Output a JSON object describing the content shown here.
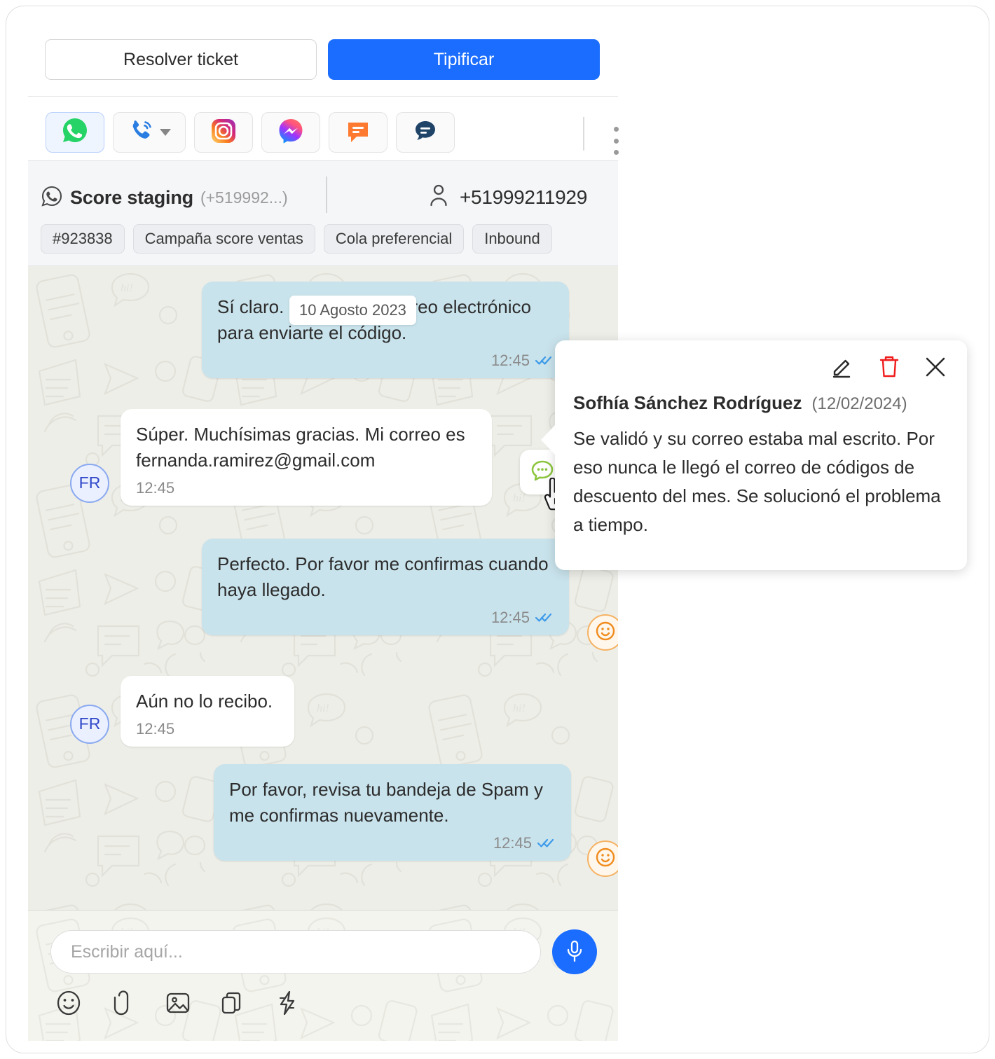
{
  "actions": {
    "resolve_label": "Resolver ticket",
    "typify_label": "Tipificar"
  },
  "channels": [
    {
      "name": "whatsapp",
      "icon": "whatsapp-icon",
      "active": true
    },
    {
      "name": "voice",
      "icon": "phone-call-icon",
      "active": false,
      "has_caret": true
    },
    {
      "name": "instagram",
      "icon": "instagram-icon",
      "active": false
    },
    {
      "name": "messenger",
      "icon": "messenger-icon",
      "active": false
    },
    {
      "name": "sms",
      "icon": "sms-bubble-icon",
      "active": false
    },
    {
      "name": "chat",
      "icon": "chat-bubble-icon",
      "active": false
    }
  ],
  "overflow_menu_icon": "kebab-menu-icon",
  "contact": {
    "channel_icon": "whatsapp-outline-icon",
    "account_name": "Score staging",
    "account_number": "(+519992...)",
    "person_icon": "person-icon",
    "phone": "+51999211929",
    "tags": [
      "#923838",
      "Campaña score ventas",
      "Cola preferencial",
      "Inbound"
    ]
  },
  "chat": {
    "date_divider": "10 Agosto 2023",
    "messages": [
      {
        "id": "m1",
        "direction": "out",
        "text": "Sí claro. Envíame tu correo electrónico para enviarte el código.",
        "time": "12:45",
        "status": "read",
        "avatar": null,
        "reaction": null
      },
      {
        "id": "m2",
        "direction": "in",
        "text": "Súper. Muchísimas gracias. Mi correo es fernanda.ramirez@gmail.com",
        "time": "12:45",
        "status": "none",
        "avatar": "FR",
        "reaction": null
      },
      {
        "id": "m3",
        "direction": "out",
        "text": "Perfecto. Por favor me confirmas cuando haya llegado.",
        "time": "12:45",
        "status": "read",
        "avatar": null,
        "reaction": "smiley-reaction-icon"
      },
      {
        "id": "m4",
        "direction": "in",
        "text": "Aún no lo recibo.",
        "time": "12:45",
        "status": "none",
        "avatar": "FR",
        "reaction": null
      },
      {
        "id": "m5",
        "direction": "out",
        "text": "Por favor, revisa tu bandeja de Spam y me confirmas nuevamente.",
        "time": "12:45",
        "status": "read",
        "avatar": null,
        "reaction": "smiley-reaction-icon"
      }
    ],
    "note_button_icon": "comment-note-icon"
  },
  "note_popup": {
    "edit_icon": "pencil-edit-icon",
    "delete_icon": "trash-delete-icon",
    "close_icon": "close-x-icon",
    "author": "Sofhía Sánchez Rodríguez",
    "date": "(12/02/2024)",
    "body": "Se validó y su correo estaba mal escrito. Por eso nunca le llegó el correo de códigos de descuento del mes. Se solucionó el problema a tiempo."
  },
  "composer": {
    "placeholder": "Escribir aquí...",
    "value": "",
    "mic_icon": "microphone-icon",
    "tools": [
      {
        "name": "emoji-icon"
      },
      {
        "name": "attachment-paperclip-icon"
      },
      {
        "name": "image-icon"
      },
      {
        "name": "templates-copy-icon"
      },
      {
        "name": "quick-reply-lightning-icon"
      }
    ]
  },
  "colors": {
    "primary_blue": "#1A6DFF",
    "outgoing_bubble": "#c9e3ec",
    "chat_background": "#eeeee8",
    "reaction_orange": "#f5b263",
    "delete_red": "#f01c1c",
    "note_green": "#7ac943"
  }
}
